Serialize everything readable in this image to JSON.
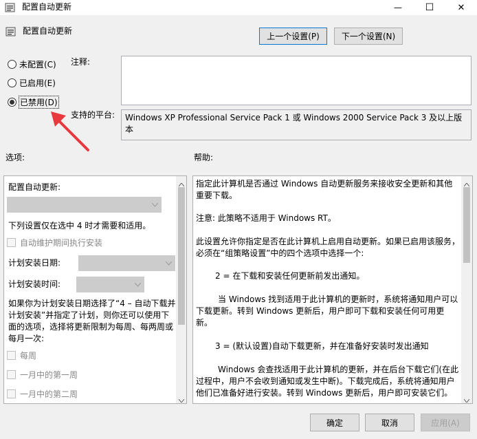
{
  "window": {
    "title": "配置自动更新",
    "minimize_glyph": "—",
    "maximize_glyph": "☐",
    "close_glyph": "✕"
  },
  "header": {
    "title": "配置自动更新",
    "prev_setting": "上一个设置(P)",
    "next_setting": "下一个设置(N)"
  },
  "state": {
    "options": [
      {
        "label": "未配置(C)",
        "selected": false
      },
      {
        "label": "已启用(E)",
        "selected": false
      },
      {
        "label": "已禁用(D)",
        "selected": true
      }
    ]
  },
  "comment": {
    "label": "注释:",
    "value": ""
  },
  "platform": {
    "label": "支持的平台:",
    "value": "Windows XP Professional Service Pack 1 或 Windows 2000 Service Pack 3 及以上版本"
  },
  "options_section": {
    "label": "选项:",
    "configure_label": "配置自动更新:",
    "note": "下列设置仅在选中 4 时才需要和适用。",
    "maintenance_checkbox": "自动维护期间执行安装",
    "schedule_day_label": "计划安装日期:",
    "schedule_time_label": "计划安装时间:",
    "long_note": "如果你为计划安装日期选择了“4 – 自动下载并计划安装”并指定了计划，则你还可以使用下面的选项，选择将更新限制为每周、每两周或每月一次:",
    "weekly_checkbox": "每周",
    "first_week_checkbox": "一月中的第一周",
    "second_week_checkbox": "一月中的第二周"
  },
  "help_section": {
    "label": "帮助:",
    "paragraphs": [
      "指定此计算机是否通过 Windows 自动更新服务来接收安全更新和其他重要下载。",
      "注意: 此策略不适用于 Windows RT。",
      "此设置允许你指定是否在此计算机上启用自动更新。如果已启用该服务，必须在“组策略设置”中的四个选项中选择一个:",
      "2 = 在下载和安装任何更新前发出通知。",
      "当 Windows 找到适用于此计算机的更新时，系统将通知用户可以下载更新。转到 Windows 更新后，用户即可下载和安装任何可用更新。",
      "3 = (默认设置)自动下载更新，并在准备好安装时发出通知",
      "Windows 会查找适用于此计算机的更新，并在后台下载它们(在此过程中，用户不会收到通知或发生中断)。下载完成后，系统将通知用户他们已准备好进行安装。转到 Windows 更新后，用户即可安装它们。"
    ]
  },
  "footer": {
    "ok": "确定",
    "cancel": "取消",
    "apply": "应用(A)"
  },
  "colors": {
    "annotation_arrow": "#e8393f",
    "focus_border": "#0078d7"
  }
}
